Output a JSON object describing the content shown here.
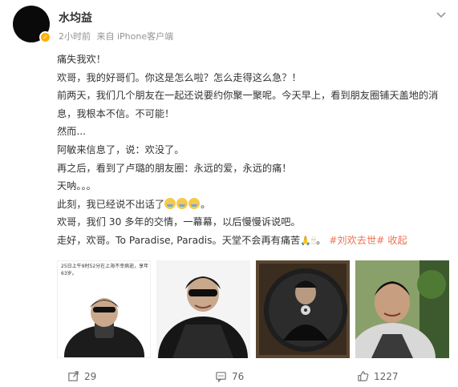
{
  "user": {
    "name": "水均益"
  },
  "meta": {
    "time": "2小时前",
    "source": "来自 iPhone客户端"
  },
  "post": {
    "lines": [
      "痛失我欢！",
      "欢哥，我的好哥们。你这是怎么啦？怎么走得这么急？！",
      "前两天，我们几个朋友在一起还说要约你聚一聚呢。今天早上，看到朋友圈铺天盖地的消息，我根本不信。不可能！",
      "然而...",
      "阿敏来信息了，说：欢没了。",
      "再之后，看到了卢璐的朋友圈：永远的爱，永远的痛！",
      "天呐。。。",
      "此刻，我已经说不出话了",
      "欢哥，我们 30 多年的交情，一幕幕，以后慢慢诉说吧。",
      "走好，欢哥。To Paradise, Paradis。天堂不会再有痛苦"
    ],
    "hashtag": "#刘欢去世#",
    "collapse": "收起"
  },
  "photos": {
    "caption": "25日上午9时52分在上海不幸病逝，享年63岁。"
  },
  "actions": {
    "share_count": "29",
    "comment_count": "76",
    "like_count": "1227"
  },
  "colors": {
    "accent": "#eb7350",
    "verify": "#ffb000"
  }
}
